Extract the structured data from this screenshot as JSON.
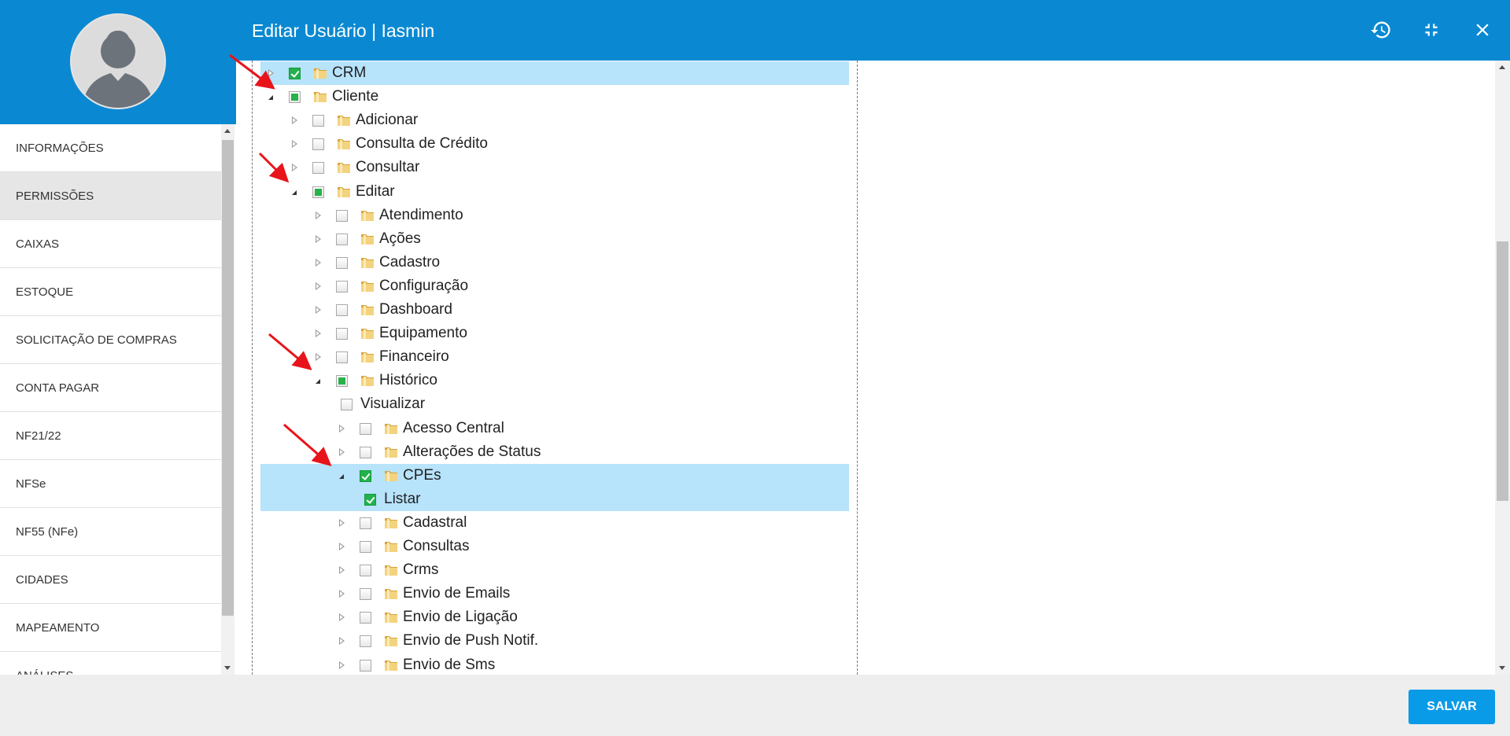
{
  "header": {
    "title": "Editar Usuário | Iasmin",
    "history_icon": "history-icon",
    "collapse_icon": "fullscreen-exit-icon",
    "close_icon": "close-icon"
  },
  "sidebar": {
    "items": [
      {
        "label": "INFORMAÇÕES",
        "active": false
      },
      {
        "label": "PERMISSÕES",
        "active": true
      },
      {
        "label": "CAIXAS",
        "active": false
      },
      {
        "label": "ESTOQUE",
        "active": false
      },
      {
        "label": "SOLICITAÇÃO DE COMPRAS",
        "active": false
      },
      {
        "label": "CONTA PAGAR",
        "active": false
      },
      {
        "label": "NF21/22",
        "active": false
      },
      {
        "label": "NFSe",
        "active": false
      },
      {
        "label": "NF55 (NFe)",
        "active": false
      },
      {
        "label": "CIDADES",
        "active": false
      },
      {
        "label": "MAPEAMENTO",
        "active": false
      },
      {
        "label": "ANÁLISES",
        "active": false
      }
    ]
  },
  "tree": {
    "rows": [
      {
        "label": "CRM",
        "level": 0,
        "toggle": "collapsed",
        "check": "checked",
        "folder": true,
        "selected": true
      },
      {
        "label": "Cliente",
        "level": 0,
        "toggle": "expanded",
        "check": "partial",
        "folder": true,
        "selected": false
      },
      {
        "label": "Adicionar",
        "level": 1,
        "toggle": "collapsed",
        "check": "none",
        "folder": true,
        "selected": false
      },
      {
        "label": "Consulta de Crédito",
        "level": 1,
        "toggle": "collapsed",
        "check": "none",
        "folder": true,
        "selected": false
      },
      {
        "label": "Consultar",
        "level": 1,
        "toggle": "collapsed",
        "check": "none",
        "folder": true,
        "selected": false
      },
      {
        "label": "Editar",
        "level": 1,
        "toggle": "expanded",
        "check": "partial",
        "folder": true,
        "selected": false
      },
      {
        "label": "Atendimento",
        "level": 2,
        "toggle": "collapsed",
        "check": "none",
        "folder": true,
        "selected": false
      },
      {
        "label": "Ações",
        "level": 2,
        "toggle": "collapsed",
        "check": "none",
        "folder": true,
        "selected": false
      },
      {
        "label": "Cadastro",
        "level": 2,
        "toggle": "collapsed",
        "check": "none",
        "folder": true,
        "selected": false
      },
      {
        "label": "Configuração",
        "level": 2,
        "toggle": "collapsed",
        "check": "none",
        "folder": true,
        "selected": false
      },
      {
        "label": "Dashboard",
        "level": 2,
        "toggle": "collapsed",
        "check": "none",
        "folder": true,
        "selected": false
      },
      {
        "label": "Equipamento",
        "level": 2,
        "toggle": "collapsed",
        "check": "none",
        "folder": true,
        "selected": false
      },
      {
        "label": "Financeiro",
        "level": 2,
        "toggle": "collapsed",
        "check": "none",
        "folder": true,
        "selected": false
      },
      {
        "label": "Histórico",
        "level": 2,
        "toggle": "expanded",
        "check": "partial",
        "folder": true,
        "selected": false
      },
      {
        "label": "Visualizar",
        "level": 3,
        "toggle": "none",
        "check": "none",
        "folder": false,
        "selected": false
      },
      {
        "label": "Acesso Central",
        "level": 3,
        "toggle": "collapsed",
        "check": "none",
        "folder": true,
        "selected": false
      },
      {
        "label": "Alterações de Status",
        "level": 3,
        "toggle": "collapsed",
        "check": "none",
        "folder": true,
        "selected": false
      },
      {
        "label": "CPEs",
        "level": 3,
        "toggle": "expanded",
        "check": "checked",
        "folder": true,
        "selected": true
      },
      {
        "label": "Listar",
        "level": 4,
        "toggle": "none",
        "check": "checked",
        "folder": false,
        "selected": true
      },
      {
        "label": "Cadastral",
        "level": 3,
        "toggle": "collapsed",
        "check": "none",
        "folder": true,
        "selected": false
      },
      {
        "label": "Consultas",
        "level": 3,
        "toggle": "collapsed",
        "check": "none",
        "folder": true,
        "selected": false
      },
      {
        "label": "Crms",
        "level": 3,
        "toggle": "collapsed",
        "check": "none",
        "folder": true,
        "selected": false
      },
      {
        "label": "Envio de Emails",
        "level": 3,
        "toggle": "collapsed",
        "check": "none",
        "folder": true,
        "selected": false
      },
      {
        "label": "Envio de Ligação",
        "level": 3,
        "toggle": "collapsed",
        "check": "none",
        "folder": true,
        "selected": false
      },
      {
        "label": "Envio de Push Notif.",
        "level": 3,
        "toggle": "collapsed",
        "check": "none",
        "folder": true,
        "selected": false
      },
      {
        "label": "Envio de Sms",
        "level": 3,
        "toggle": "collapsed",
        "check": "none",
        "folder": true,
        "selected": false
      }
    ]
  },
  "footer": {
    "save_label": "SALVAR"
  },
  "colors": {
    "header_blue": "#0a89d2",
    "save_blue": "#0a9be8",
    "selection": "#b7e3fb",
    "check_green": "#22b14c",
    "annotation_red": "#e8141b"
  }
}
